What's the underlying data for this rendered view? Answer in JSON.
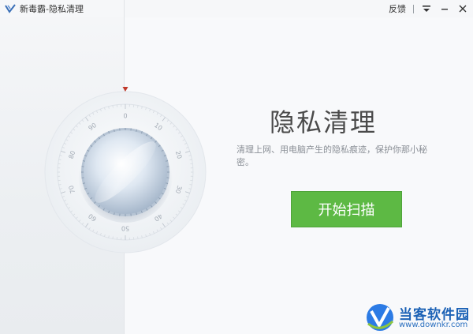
{
  "app": {
    "title": "新毒霸-隐私清理",
    "feedback_label": "反馈"
  },
  "main": {
    "heading": "隐私清理",
    "subtitle": "清理上网、用电脑产生的隐私痕迹，保护你那小秘密。",
    "start_button_label": "开始扫描"
  },
  "dial": {
    "tick_labels": [
      "0",
      "10",
      "20",
      "30",
      "40",
      "50",
      "60",
      "70",
      "80",
      "90"
    ]
  },
  "watermark": {
    "title": "当客软件园",
    "url": "www.downkr.com"
  },
  "colors": {
    "accent_green": "#5db944",
    "pointer_red": "#c0392b",
    "watermark_blue": "#1c62b6"
  },
  "icons": {
    "app_logo": "kingsoft-logo-icon",
    "menu": "menu-icon",
    "minimize": "minimize-icon",
    "close": "close-icon",
    "dial_pointer": "triangle-pointer-icon"
  }
}
